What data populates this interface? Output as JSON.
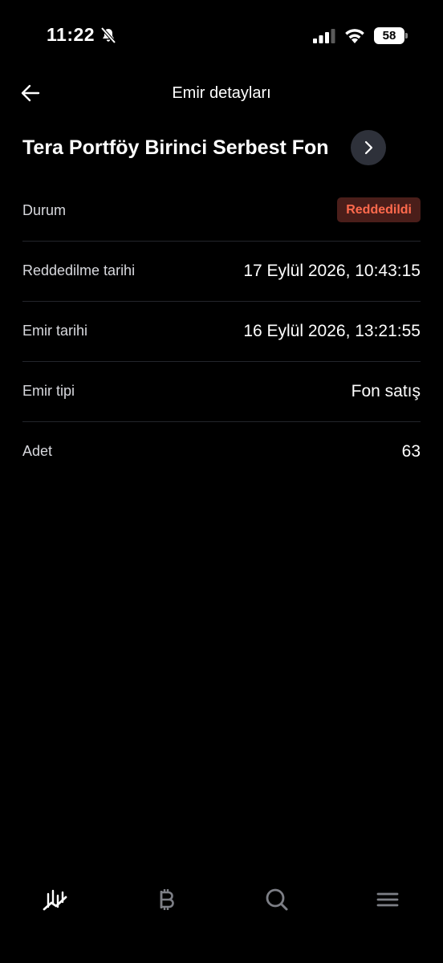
{
  "status_bar": {
    "time": "11:22",
    "battery": "58"
  },
  "header": {
    "title": "Emir detayları"
  },
  "fund": {
    "name": "Tera Portföy Birinci Serbest Fon"
  },
  "details": {
    "status_label": "Durum",
    "status_value": "Reddedildi",
    "rejected_date_label": "Reddedilme tarihi",
    "rejected_date_value": "17 Eylül 2026, 10:43:15",
    "order_date_label": "Emir tarihi",
    "order_date_value": "16 Eylül 2026, 13:21:55",
    "order_type_label": "Emir tipi",
    "order_type_value": "Fon satış",
    "quantity_label": "Adet",
    "quantity_value": "63"
  },
  "colors": {
    "background": "#000000",
    "badge_bg": "#4a1e1a",
    "badge_text": "#ff6a4d",
    "divider": "#23252b",
    "nav_active": "#ffffff",
    "nav_inactive": "#7d7f86"
  },
  "icons": {
    "back": "arrow-left-icon",
    "fund_open": "chevron-right-icon",
    "nav": [
      "chart-trend-icon",
      "bitcoin-icon",
      "search-icon",
      "menu-icon"
    ]
  }
}
